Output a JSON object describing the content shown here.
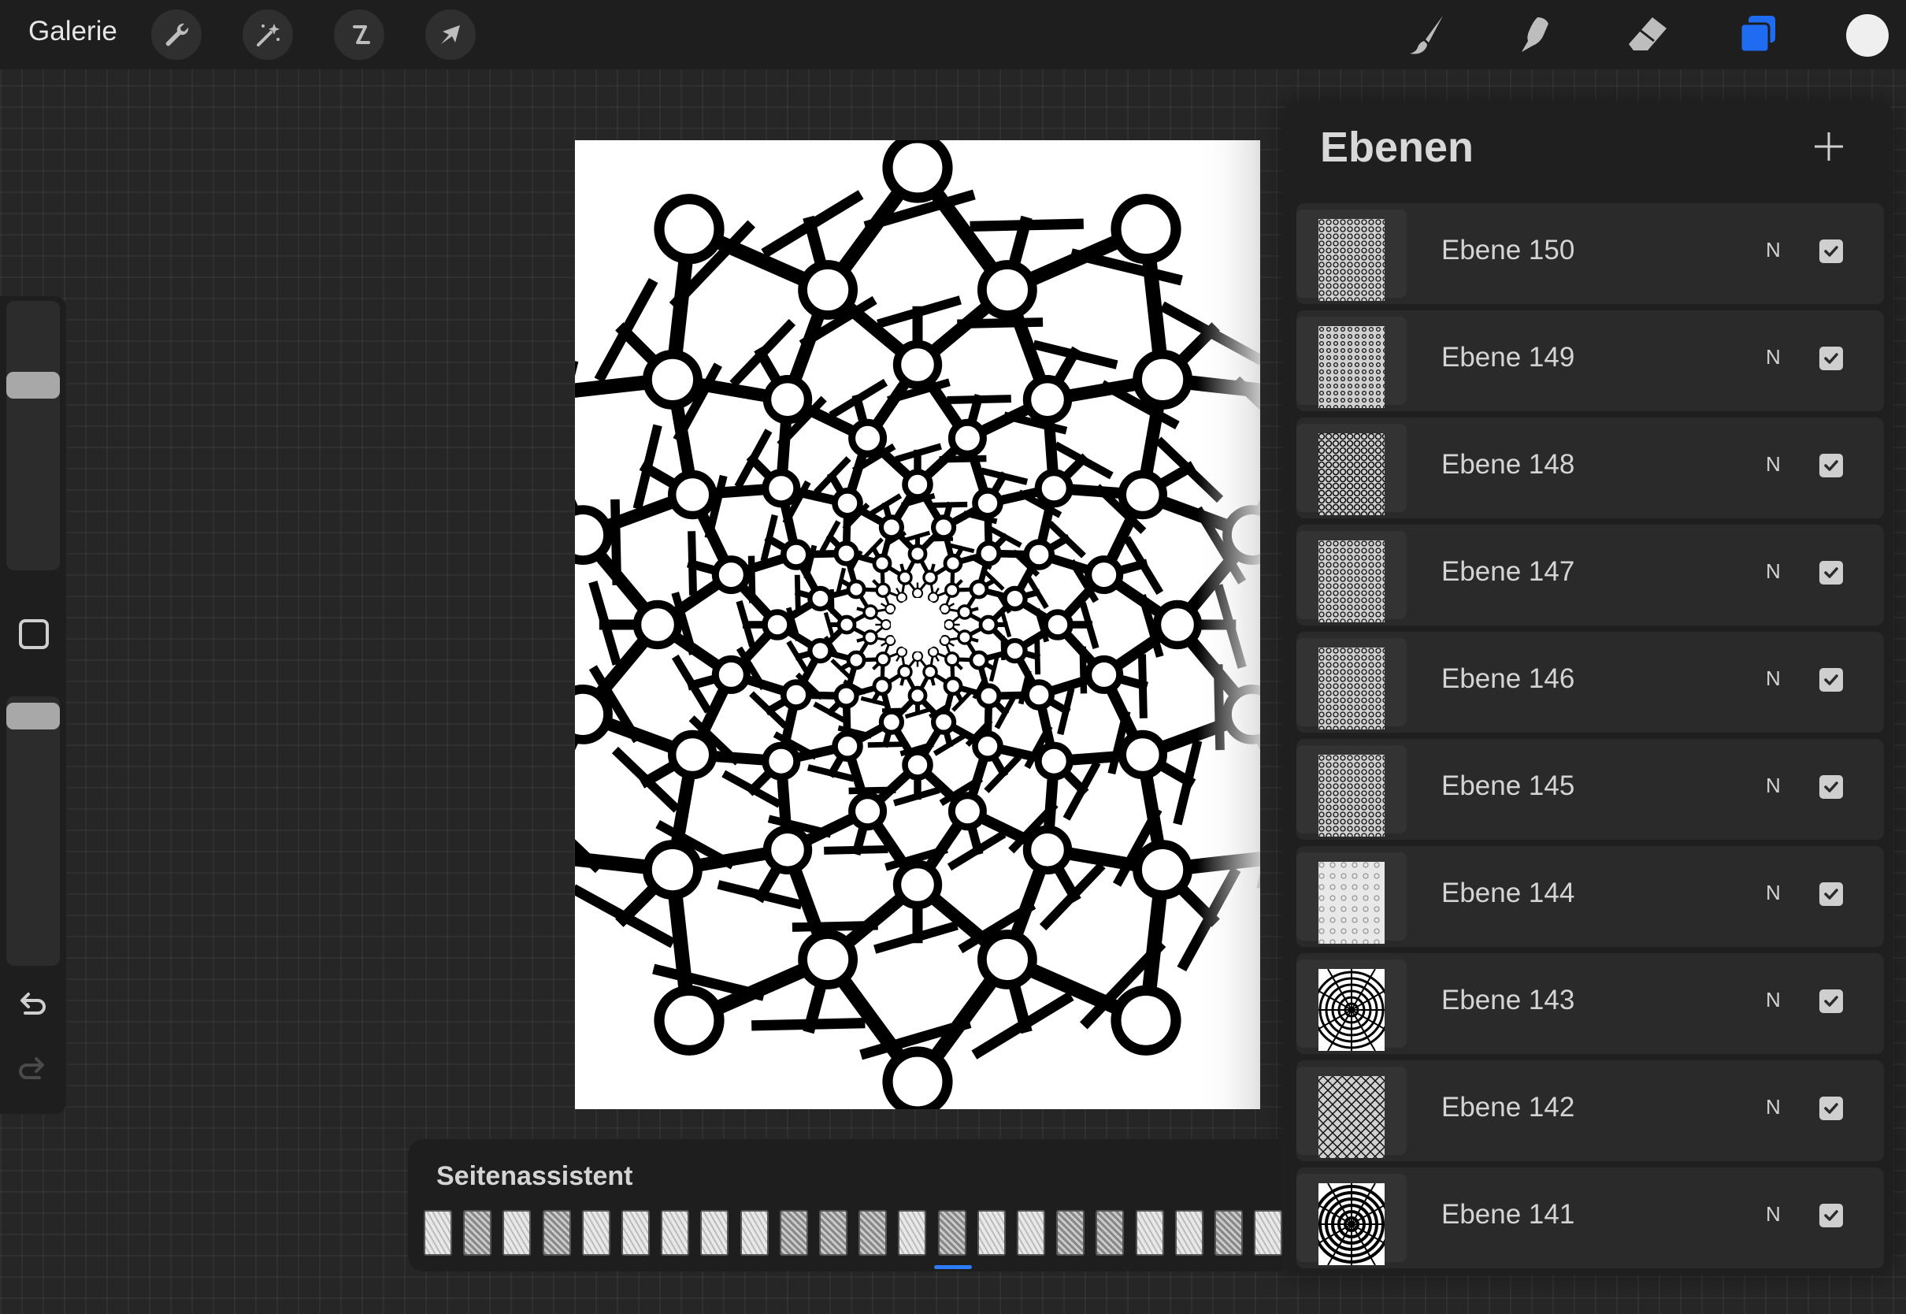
{
  "topbar": {
    "gallery_label": "Galerie",
    "left_tools": [
      "wrench-icon",
      "magic-wand-icon",
      "selection-icon",
      "transform-arrow-icon"
    ],
    "right_tools": [
      "brush-icon",
      "smudge-icon",
      "eraser-icon",
      "layers-icon"
    ],
    "active_tool": "layers-icon",
    "accent_color": "#1f6bf2",
    "current_color": "#efefef"
  },
  "sidebar": {
    "brush_size_level": 0.3,
    "opacity_level": 0.06,
    "icons": [
      "modify-square-icon",
      "undo-icon",
      "redo-icon"
    ]
  },
  "layers": {
    "title": "Ebenen",
    "add_icon": "plus-icon",
    "items": [
      {
        "name": "Ebene 150",
        "mode": "N",
        "visible": true
      },
      {
        "name": "Ebene 149",
        "mode": "N",
        "visible": true
      },
      {
        "name": "Ebene 148",
        "mode": "N",
        "visible": true
      },
      {
        "name": "Ebene 147",
        "mode": "N",
        "visible": true
      },
      {
        "name": "Ebene 146",
        "mode": "N",
        "visible": true
      },
      {
        "name": "Ebene 145",
        "mode": "N",
        "visible": true
      },
      {
        "name": "Ebene 144",
        "mode": "N",
        "visible": true
      },
      {
        "name": "Ebene 143",
        "mode": "N",
        "visible": true
      },
      {
        "name": "Ebene 142",
        "mode": "N",
        "visible": true
      },
      {
        "name": "Ebene 141",
        "mode": "N",
        "visible": true
      }
    ]
  },
  "assistant": {
    "title": "Seitenassistent",
    "page_count": 22
  }
}
